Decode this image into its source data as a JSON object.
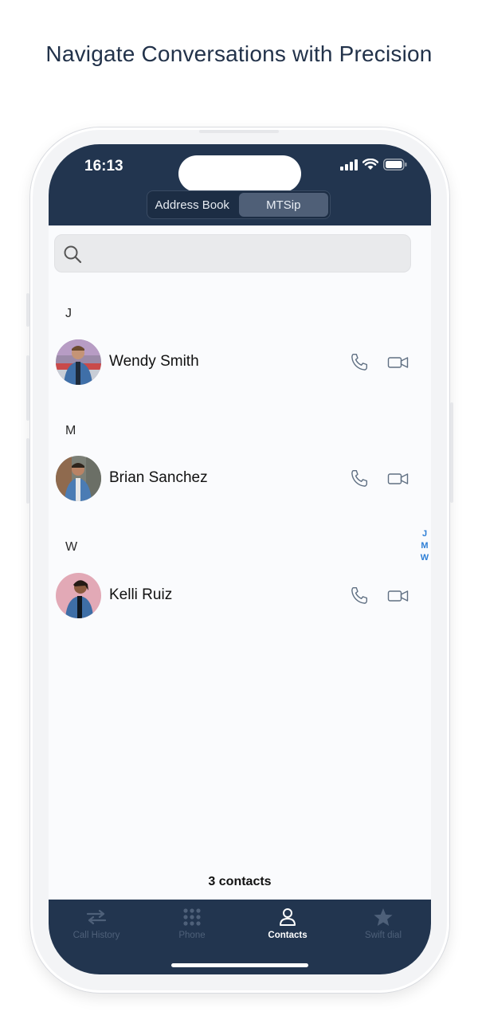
{
  "headline": "Navigate Conversations with Precision",
  "status_bar": {
    "time": "16:13"
  },
  "segmented_control": {
    "options": [
      "Address Book",
      "MTSip"
    ],
    "selected": "MTSip"
  },
  "search": {
    "placeholder": "",
    "value": ""
  },
  "sections": [
    {
      "letter": "J",
      "contacts": [
        {
          "name": "Wendy Smith"
        }
      ]
    },
    {
      "letter": "M",
      "contacts": [
        {
          "name": "Brian Sanchez"
        }
      ]
    },
    {
      "letter": "W",
      "contacts": [
        {
          "name": "Kelli Ruiz"
        }
      ]
    }
  ],
  "index_letters": [
    "J",
    "M",
    "W"
  ],
  "contact_count": "3 contacts",
  "tab_bar": {
    "tabs": [
      {
        "label": "Call History",
        "icon": "swap-arrows-icon",
        "active": false
      },
      {
        "label": "Phone",
        "icon": "keypad-icon",
        "active": false
      },
      {
        "label": "Contacts",
        "icon": "person-icon",
        "active": true
      },
      {
        "label": "Swift dial",
        "icon": "star-icon",
        "active": false
      }
    ]
  },
  "colors": {
    "header_bg": "#22354f",
    "accent_blue": "#2e7fd6",
    "inactive_tab": "#4e6079",
    "screen_bg": "#fafbfd"
  }
}
